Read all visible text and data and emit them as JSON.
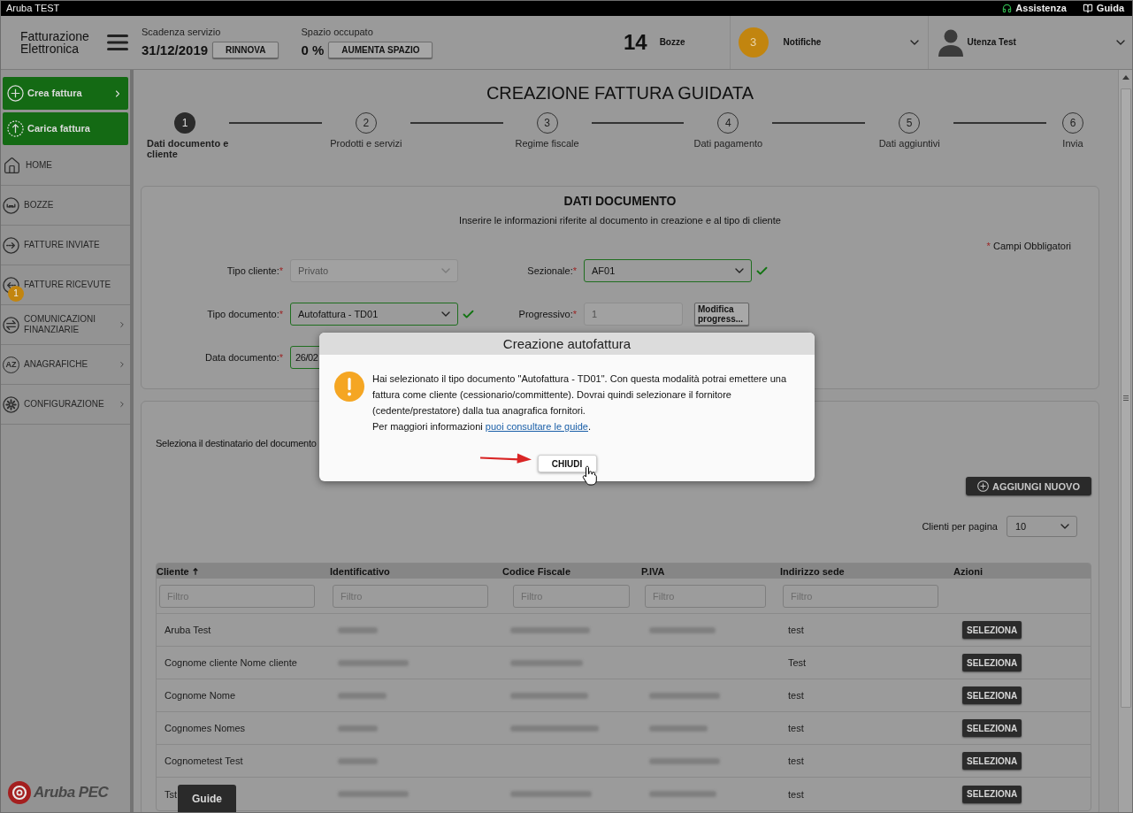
{
  "top_bar": {
    "title": "Aruba TEST",
    "links": [
      {
        "label": "Assistenza"
      },
      {
        "label": "Guida"
      }
    ]
  },
  "header": {
    "logo": "Fatturazione Elettronica",
    "service": {
      "label": "Scadenza servizio",
      "value": "31/12/2019",
      "button": "RINNOVA"
    },
    "storage": {
      "label": "Spazio occupato",
      "value": "0 %",
      "button": "AUMENTA SPAZIO"
    },
    "drafts": {
      "count": "14",
      "label": "Bozze"
    },
    "notifications": {
      "count": "3",
      "label": "Notifiche"
    },
    "user": {
      "name": "Utenza Test"
    }
  },
  "sidebar": {
    "actions": [
      {
        "label": "Crea fattura",
        "submenu": true
      },
      {
        "label": "Carica fattura",
        "submenu": false
      }
    ],
    "items": [
      {
        "label": "HOME",
        "submenu": false
      },
      {
        "label": "BOZZE",
        "submenu": false
      },
      {
        "label": "FATTURE INVIATE",
        "submenu": false
      },
      {
        "label": "FATTURE RICEVUTE",
        "submenu": false,
        "badge": "1"
      },
      {
        "label": "COMUNICAZIONI FINANZIARIE",
        "submenu": true
      },
      {
        "label": "ANAGRAFICHE",
        "submenu": true,
        "icon_text": "AZ"
      },
      {
        "label": "CONFIGURAZIONE",
        "submenu": true
      }
    ],
    "logo": "Aruba PEC"
  },
  "page": {
    "title": "CREAZIONE FATTURA GUIDATA",
    "steps": [
      {
        "number": "1",
        "label": "Dati documento e cliente",
        "selected": true
      },
      {
        "number": "2",
        "label": "Prodotti e servizi",
        "selected": false
      },
      {
        "number": "3",
        "label": "Regime fiscale",
        "selected": false
      },
      {
        "number": "4",
        "label": "Dati pagamento",
        "selected": false
      },
      {
        "number": "5",
        "label": "Dati aggiuntivi",
        "selected": false
      },
      {
        "number": "6",
        "label": "Invia",
        "selected": false
      }
    ]
  },
  "document_panel": {
    "title": "DATI DOCUMENTO",
    "subtitle": "Inserire le informazioni riferite al documento in creazione e al tipo di cliente",
    "required_note": {
      "mark": "*",
      "text": "Campi Obbligatori"
    },
    "rows": [
      [
        {
          "label": "Tipo cliente:",
          "mark": "*",
          "kind": "select",
          "value": "Privato",
          "disabled": true,
          "valid": false
        },
        {
          "label": "Sezionale:",
          "mark": "*",
          "kind": "select",
          "value": "AF01",
          "disabled": false,
          "valid": true
        }
      ],
      [
        {
          "label": "Tipo documento:",
          "mark": "*",
          "kind": "select",
          "value": "Autofattura - TD01",
          "disabled": false,
          "valid": true
        },
        {
          "label": "Progressivo:",
          "mark": "*",
          "kind": "text",
          "value": "1",
          "disabled": true,
          "valid": false,
          "button": "Modifica progress..."
        }
      ],
      [
        {
          "label": "Data documento:",
          "mark": "*",
          "kind": "date",
          "value": "26/02",
          "disabled": false,
          "valid": true
        }
      ]
    ]
  },
  "recipient_panel": {
    "prompt": "Seleziona il destinatario del documento",
    "add_button": "AGGIUNGI NUOVO",
    "page_size": {
      "label": "Clienti per pagina",
      "value": "10"
    },
    "table": {
      "columns": [
        {
          "label": "Cliente",
          "sorted": true,
          "placeholder": "Filtro"
        },
        {
          "label": "Identificativo",
          "sorted": false,
          "placeholder": "Filtro"
        },
        {
          "label": "Codice Fiscale",
          "sorted": false,
          "placeholder": "Filtro"
        },
        {
          "label": "P.IVA",
          "sorted": false,
          "placeholder": "Filtro"
        },
        {
          "label": "Indirizzo sede",
          "sorted": false,
          "placeholder": "Filtro"
        },
        {
          "label": "Azioni",
          "sorted": false
        }
      ],
      "rows": [
        {
          "cells": [
            {
              "text": "Aruba Test"
            },
            {
              "blurred": true
            },
            {
              "blurred": true
            },
            {
              "blurred": true
            },
            {
              "text": "test"
            }
          ],
          "action": "SELEZIONA"
        },
        {
          "cells": [
            {
              "text": "Cognome cliente Nome cliente"
            },
            {
              "blurred": true
            },
            {
              "blurred": true
            },
            {
              "blurred": false
            },
            {
              "text": "Test"
            }
          ],
          "action": "SELEZIONA"
        },
        {
          "cells": [
            {
              "text": "Cognome Nome"
            },
            {
              "blurred": true
            },
            {
              "blurred": true
            },
            {
              "blurred": true
            },
            {
              "text": "test"
            }
          ],
          "action": "SELEZIONA"
        },
        {
          "cells": [
            {
              "text": "Cognomes Nomes"
            },
            {
              "blurred": true
            },
            {
              "blurred": true
            },
            {
              "blurred": true
            },
            {
              "text": "test"
            }
          ],
          "action": "SELEZIONA"
        },
        {
          "cells": [
            {
              "text": "Cognometest Test"
            },
            {
              "blurred": true
            },
            {
              "blurred": false
            },
            {
              "blurred": true
            },
            {
              "text": "test"
            }
          ],
          "action": "SELEZIONA"
        },
        {
          "cells": [
            {
              "text": "Tst"
            },
            {
              "blurred": true
            },
            {
              "blurred": true
            },
            {
              "blurred": true
            },
            {
              "text": "test"
            }
          ],
          "action": "SELEZIONA"
        }
      ]
    }
  },
  "modal": {
    "title": "Creazione autofattura",
    "message": "Hai selezionato il tipo documento \"Autofattura - TD01\". Con questa modalità potrai emettere una fattura come cliente (cessionario/committente). Dovrai quindi selezionare il fornitore (cedente/prestatore) dalla tua anagrafica fornitori.",
    "more_info": {
      "text": "Per maggiori informazioni",
      "link": "puoi consultare le guide",
      "end": "."
    },
    "button": "CHIUDI"
  },
  "guide_tab": "Guide"
}
